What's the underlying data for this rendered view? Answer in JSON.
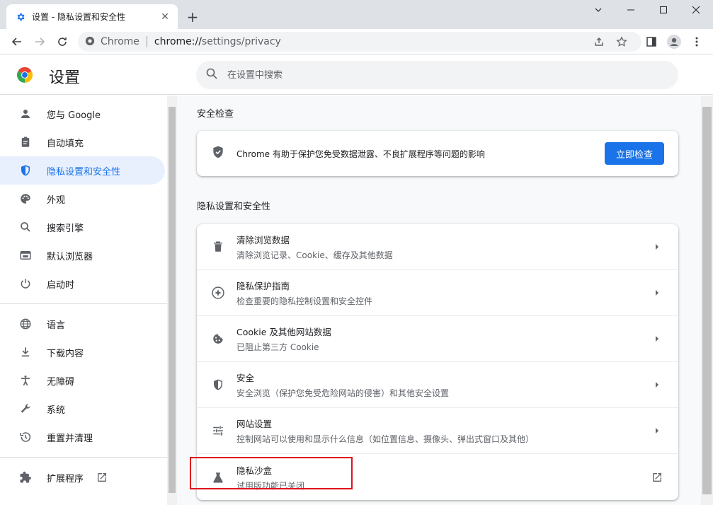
{
  "tab": {
    "title": "设置 - 隐私设置和安全性",
    "close": "✕"
  },
  "newtab": "+",
  "window": {
    "minimize": "—",
    "restore": "☐",
    "close": "✕"
  },
  "omnibox": {
    "site": "Chrome",
    "url_host": "chrome://",
    "url_path": "settings/privacy"
  },
  "header": {
    "title": "设置",
    "search_placeholder": "在设置中搜索"
  },
  "sidebar": {
    "items": [
      {
        "label": "您与 Google",
        "icon": "person-icon"
      },
      {
        "label": "自动填充",
        "icon": "clipboard-icon"
      },
      {
        "label": "隐私设置和安全性",
        "icon": "shield-icon",
        "active": true
      },
      {
        "label": "外观",
        "icon": "palette-icon"
      },
      {
        "label": "搜索引擎",
        "icon": "search-icon"
      },
      {
        "label": "默认浏览器",
        "icon": "browser-icon"
      },
      {
        "label": "启动时",
        "icon": "power-icon"
      },
      {
        "label": "语言",
        "icon": "globe-icon"
      },
      {
        "label": "下载内容",
        "icon": "download-icon"
      },
      {
        "label": "无障碍",
        "icon": "accessibility-icon"
      },
      {
        "label": "系统",
        "icon": "wrench-icon"
      },
      {
        "label": "重置并清理",
        "icon": "history-icon"
      },
      {
        "label": "扩展程序",
        "icon": "puzzle-icon"
      }
    ]
  },
  "safety_check": {
    "title": "安全检查",
    "text": "Chrome 有助于保护您免受数据泄露、不良扩展程序等问题的影响",
    "button": "立即检查"
  },
  "privacy": {
    "title": "隐私设置和安全性",
    "rows": [
      {
        "title": "清除浏览数据",
        "subtitle": "清除浏览记录、Cookie、缓存及其他数据",
        "icon": "trash-icon"
      },
      {
        "title": "隐私保护指南",
        "subtitle": "检查重要的隐私控制设置和安全控件",
        "icon": "compass-icon"
      },
      {
        "title": "Cookie 及其他网站数据",
        "subtitle": "已阻止第三方 Cookie",
        "icon": "cookie-icon"
      },
      {
        "title": "安全",
        "subtitle": "安全浏览（保护您免受危险网站的侵害）和其他安全设置",
        "icon": "shield-icon"
      },
      {
        "title": "网站设置",
        "subtitle": "控制网站可以使用和显示什么信息（如位置信息、摄像头、弹出式窗口及其他）",
        "icon": "tune-icon"
      },
      {
        "title": "隐私沙盒",
        "subtitle": "试用版功能已关闭",
        "icon": "flask-icon"
      }
    ]
  },
  "colors": {
    "accent": "#1a73e8",
    "highlight": "#e0121c"
  }
}
